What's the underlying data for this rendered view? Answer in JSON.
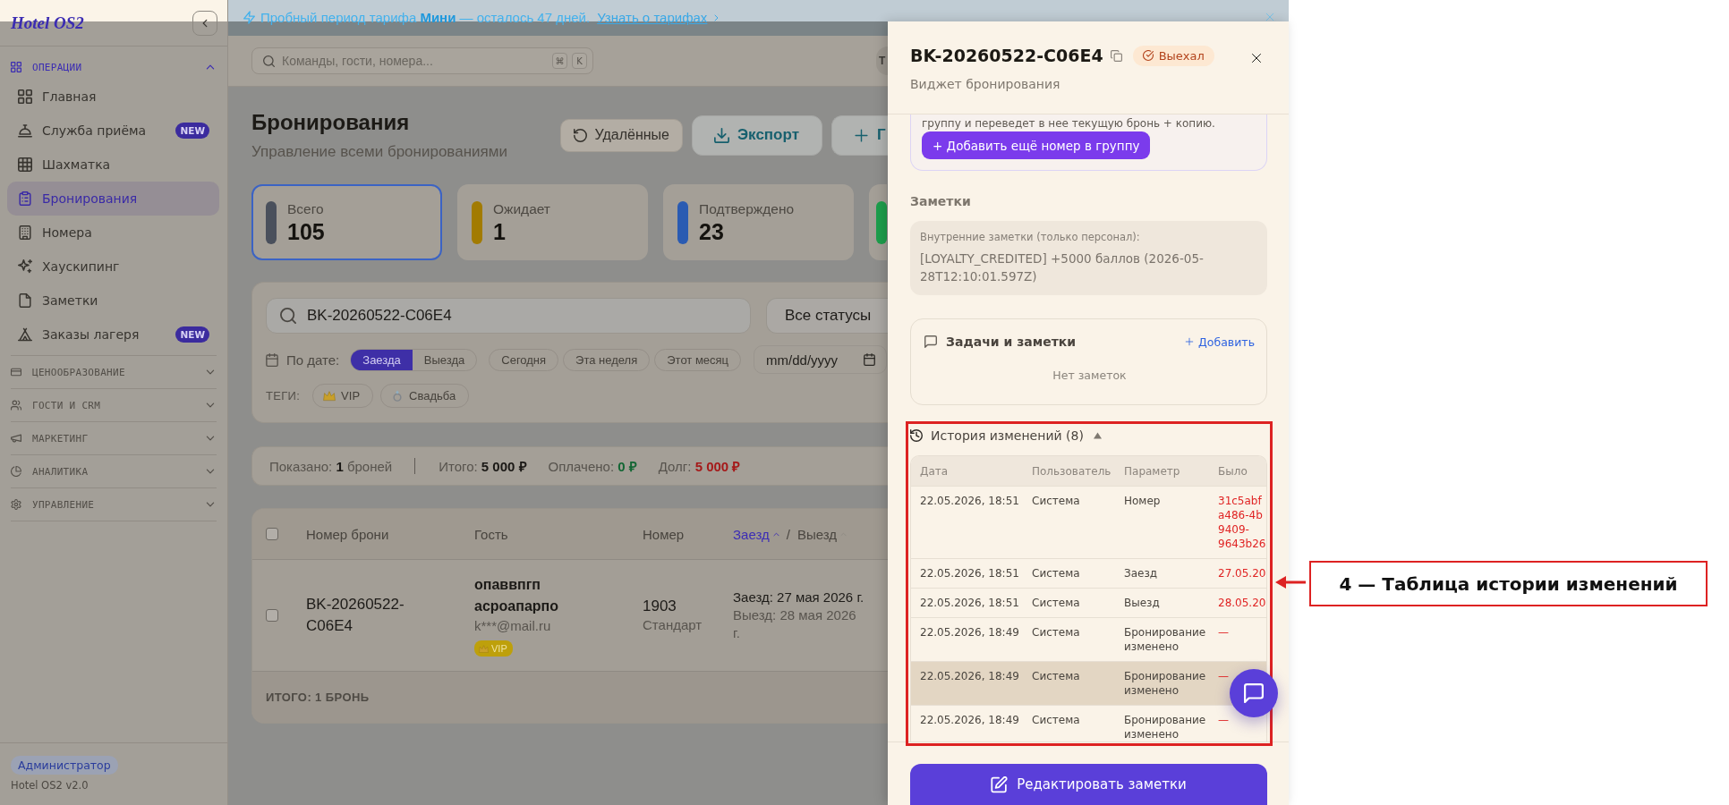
{
  "banner": {
    "message": "Пробный период тарифа **Мини** — осталось 47 дней.",
    "link": "Узнать о тарифах"
  },
  "sidebar": {
    "logo": "Hotel OS2",
    "sections": [
      {
        "label": "ОПЕРАЦИИ",
        "expanded": true,
        "items": [
          {
            "label": "Главная",
            "selected": false
          },
          {
            "label": "Служба приёма",
            "selected": false,
            "badge": "NEW"
          },
          {
            "label": "Шахматка",
            "selected": false
          },
          {
            "label": "Бронирования",
            "selected": true
          },
          {
            "label": "Номера",
            "selected": false
          },
          {
            "label": "Хаускипинг",
            "selected": false
          },
          {
            "label": "Заметки",
            "selected": false
          },
          {
            "label": "Заказы лагеря",
            "selected": false,
            "badge": "NEW"
          }
        ]
      },
      {
        "label": "ЦЕНООБРАЗОВАНИЕ",
        "expanded": false
      },
      {
        "label": "ГОСТИ И CRM",
        "expanded": false
      },
      {
        "label": "МАРКЕТИНГ",
        "expanded": false
      },
      {
        "label": "АНАЛИТИКА",
        "expanded": false
      },
      {
        "label": "УПРАВЛЕНИЕ",
        "expanded": false
      }
    ],
    "role": "Администратор",
    "version": "Hotel OS2 v2.0"
  },
  "topbar": {
    "search": {
      "placeholder": "Команды, гости, номера..."
    },
    "shortcut": [
      "⌘",
      "K"
    ],
    "avatar": "Т"
  },
  "page": {
    "title": "Бронирования",
    "subtitle": "Управление всеми бронированиями",
    "actions": [
      {
        "label": "Удалённые",
        "kind": "deleted"
      },
      {
        "label": "Экспорт",
        "kind": "export"
      },
      {
        "label": "Г",
        "kind": "create"
      }
    ]
  },
  "stats": [
    {
      "label": "Всего",
      "value": "105",
      "color": "#4a505c",
      "selected": true
    },
    {
      "label": "Ожидает",
      "value": "1",
      "color": "#a27b02",
      "selected": false
    },
    {
      "label": "Подтверждено",
      "value": "23",
      "color": "#2a5bb2",
      "selected": false
    },
    {
      "color": "#1d9e4c",
      "selected": false
    }
  ],
  "filters": {
    "search": {
      "value": "BK-20260522-C06E4"
    },
    "status": "Все статусы",
    "date_label": "По дате:",
    "date_modes": [
      {
        "label": "Заезда",
        "selected": true
      },
      {
        "label": "Выезда",
        "selected": false
      }
    ],
    "ranges": [
      {
        "label": "Сегодня",
        "selected": false
      },
      {
        "label": "Эта неделя",
        "selected": false
      },
      {
        "label": "Этот месяц",
        "selected": false
      }
    ],
    "date": {
      "placeholder": "mm/dd/yyyy"
    },
    "tags_label": "ТЕГИ:",
    "tags": [
      {
        "label": "VIP",
        "kind": "vip"
      },
      {
        "label": "Свадьба",
        "kind": "wedding"
      }
    ]
  },
  "summary": {
    "shown": "Показано: **1** броней",
    "totals": [
      {
        "label": "Итого:",
        "value": "5 000 ₽",
        "kind": "total"
      },
      {
        "label": "Оплачено:",
        "value": "0 ₽",
        "kind": "paid"
      },
      {
        "label": "Долг:",
        "value": "5 000 ₽",
        "kind": "debt"
      }
    ]
  },
  "table": {
    "all_checked": false,
    "columns": [
      "Номер брони",
      "Гость",
      "Номер"
    ],
    "sort_columns": [
      {
        "label": "Заезд",
        "sorted": true
      },
      {
        "label": "Выезд",
        "sorted": false
      }
    ],
    "sort_separator": "/",
    "rows": [
      {
        "checked": false,
        "booking": "BK-20260522-C06E4",
        "guest": "опаввпгп асроапарпо",
        "email": "k***@mail.ru",
        "tag": {
          "label": "VIP",
          "kind": "vip"
        },
        "room": "1903",
        "room_type": "Стандарт",
        "check_in": "Заезд: 27 мая 2026 г.",
        "check_out": "Выезд: 28 мая 2026 г."
      }
    ],
    "footer": "ИТОГО: 1 БРОНЬ"
  },
  "drawer": {
    "title": "BK-20260522-C06E4",
    "status": {
      "label": "Выехал",
      "kind": "checked_out"
    },
    "subtitle": "Виджет бронирования",
    "group": {
      "text": "группу и переведет в нее текущую бронь + копию.",
      "button": "+ Добавить ещё номер в группу"
    },
    "notes": {
      "heading": "Заметки",
      "label": "Внутренние заметки (только персонал):",
      "text": "[LOYALTY_CREDITED] +5000 баллов (2026-05-28T12:10:01.597Z)"
    },
    "tasks": {
      "title": "Задачи и заметки",
      "add": "Добавить",
      "empty": "Нет заметок"
    },
    "history": {
      "title": "История изменений (8)",
      "expanded": true,
      "columns": [
        "Дата",
        "Пользователь",
        "Параметр",
        "Было"
      ],
      "rows": [
        {
          "date": "22.05.2026, 18:51",
          "user": "Система",
          "field": "Номер",
          "old": [
            "31c5abf",
            "a486-4b",
            "9409-",
            "9643b26"
          ],
          "highlighted": false
        },
        {
          "date": "22.05.2026, 18:51",
          "user": "Система",
          "field": "Заезд",
          "old": [
            "27.05.20"
          ],
          "highlighted": false
        },
        {
          "date": "22.05.2026, 18:51",
          "user": "Система",
          "field": "Выезд",
          "old": [
            "28.05.20"
          ],
          "highlighted": false
        },
        {
          "date": "22.05.2026, 18:49",
          "user": "Система",
          "field": "Бронирование изменено",
          "old": [
            "—"
          ],
          "highlighted": false
        },
        {
          "date": "22.05.2026, 18:49",
          "user": "Система",
          "field": "Бронирование изменено",
          "old": [
            "—"
          ],
          "highlighted": true
        },
        {
          "date": "22.05.2026, 18:49",
          "user": "Система",
          "field": "Бронирование изменено",
          "old": [
            "—"
          ],
          "highlighted": false
        }
      ]
    },
    "edit_button": "Редактировать заметки"
  },
  "annotation": {
    "label": "4 — Таблица истории изменений"
  }
}
